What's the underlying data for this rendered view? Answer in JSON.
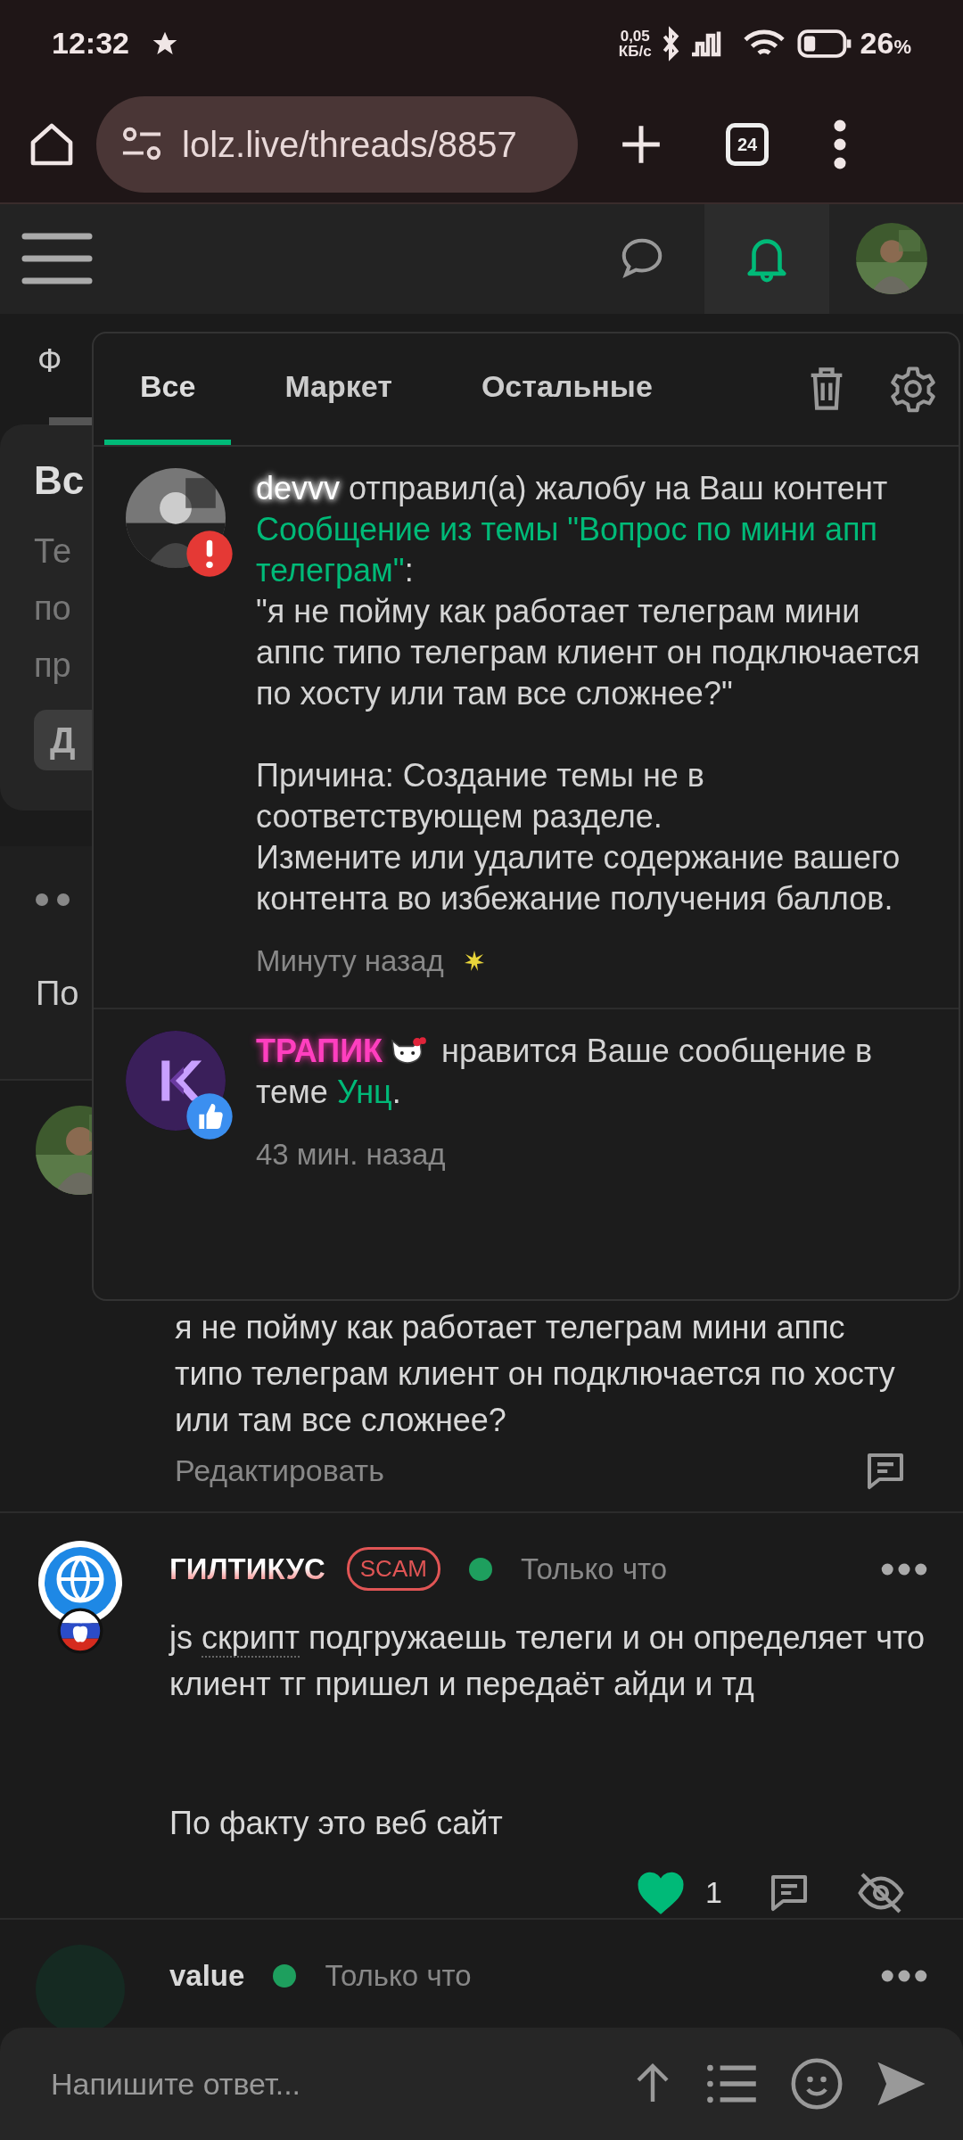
{
  "status_bar": {
    "time": "12:32",
    "net_speed": "0,05",
    "net_speed_unit": "КБ/с",
    "battery": "26",
    "battery_unit": "%"
  },
  "browser": {
    "url": "lolz.live/threads/8857",
    "tab_count": "24"
  },
  "header": {
    "buttons": [
      {
        "kind": "chat",
        "selected": false
      },
      {
        "kind": "bell",
        "selected": true
      }
    ]
  },
  "page_behind": {
    "tab": "Ф",
    "card_title": "Вс",
    "card_lines": [
      "Те",
      "по",
      "пр"
    ],
    "card_button": "Д",
    "second_card_text": "По"
  },
  "notifications": {
    "tabs": [
      {
        "label": "Все",
        "selected": true
      },
      {
        "label": "Маркет",
        "selected": false
      },
      {
        "label": "Остальные",
        "selected": false
      }
    ],
    "items": [
      {
        "kind": "report",
        "user": "devvv",
        "action": "отправил(а) жалобу на Ваш контент",
        "link": "Сообщение из темы \"Вопрос по мини апп телеграм\"",
        "link_suffix": ":",
        "quote": "\"я не пойму как работает телеграм мини аппс типо телеграм клиент он подключается по хосту или там все сложнее?\"",
        "reason": "Причина: Создание темы не в соответствующем разделе.",
        "advice": "Измените или удалите содержание вашего контента во избежание получения баллов.",
        "time": "Минуту назад",
        "unread": true
      },
      {
        "kind": "like",
        "user": "ТРАПИК",
        "user_badge": true,
        "action": "нравится Ваше сообщение в теме",
        "link": "Унц",
        "link_suffix": ".",
        "time": "43 мин. назад",
        "unread": false
      }
    ]
  },
  "posts": [
    {
      "kind": "own",
      "text": "я не пойму как работает телеграм мини аппс типо телеграм клиент он подключается по хосту или там все сложнее?",
      "edit": "Редактировать"
    },
    {
      "kind": "full",
      "author": "ГИЛТИКУС",
      "badge": "SCAM",
      "online": true,
      "time": "Только что",
      "paragraphs": [
        {
          "before": "js ",
          "term": "скрипт",
          "after": " подгружаешь телеги и он определяет что клиент тг пришел и передаёт айди и тд"
        },
        {
          "before": "По факту это веб сайт"
        }
      ],
      "likes": "1",
      "liked": true
    },
    {
      "kind": "header_only",
      "author": "value",
      "online": true,
      "time": "Только что"
    }
  ],
  "composer": {
    "placeholder": "Напишите ответ..."
  }
}
